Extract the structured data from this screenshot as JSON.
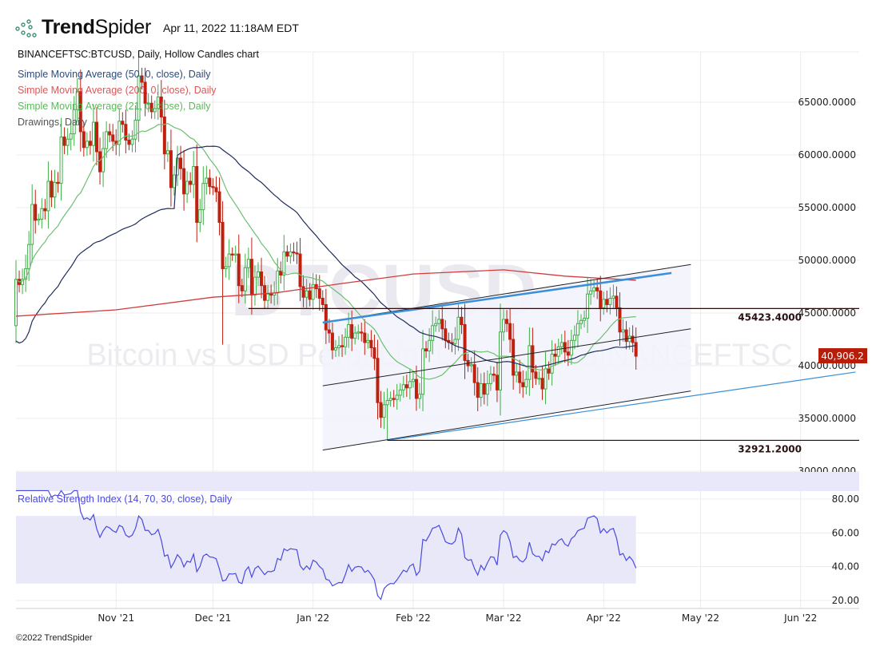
{
  "header": {
    "brand_bold": "Trend",
    "brand_light": "Spider",
    "timestamp": "Apr 11, 2022 11:18AM EDT",
    "chart_title": "BINANCEFTSC:BTCUSD, Daily, Hollow Candles chart",
    "legend": [
      {
        "label": "Simple Moving Average (50, 0, close), Daily",
        "color": "#2e4a7a"
      },
      {
        "label": "Simple Moving Average (200, 0, close), Daily",
        "color": "#d23b3b"
      },
      {
        "label": "Simple Moving Average (21, 0, close), Daily",
        "color": "#5cb85c"
      },
      {
        "label": "Drawings, Daily",
        "color": "#555555"
      }
    ]
  },
  "watermark": {
    "symbol": "BTCUSD",
    "description": "Bitcoin vs USD Perp. Lin. Contract • BINANCEFTSC"
  },
  "last_price_tag": "40,906.2",
  "footer": "©2022 TrendSpider",
  "colors": {
    "up": "#3fae49",
    "down": "#c0200f",
    "sma50": "#1f2d5c",
    "sma200": "#d23b3b",
    "sma21": "#6cc070",
    "rsi": "#4a4ae0",
    "band": "#e8e8f8",
    "channel_fill": "#f3f3fd",
    "blue_line": "#3a8fd8",
    "tag": "#b81d0a"
  },
  "chart_data": {
    "type": "candlestick",
    "title": "BINANCEFTSC:BTCUSD, Daily, Hollow Candles chart",
    "start_date": "2021-10-01",
    "first_open": 43800,
    "closes": [
      48200,
      47700,
      48200,
      49200,
      51500,
      55300,
      53800,
      53900,
      54900,
      54700,
      57500,
      56000,
      57400,
      57300,
      61700,
      60900,
      61500,
      62000,
      64300,
      66000,
      62200,
      60700,
      61300,
      60900,
      63100,
      60300,
      58400,
      60600,
      62200,
      61900,
      61300,
      61000,
      63200,
      62900,
      61400,
      61000,
      61500,
      63300,
      67500,
      66900,
      64900,
      64900,
      64100,
      64400,
      65500,
      63600,
      60100,
      60400,
      56900,
      58100,
      59700,
      58700,
      56300,
      57500,
      57200,
      58900,
      53600,
      54800,
      57300,
      57800,
      57000,
      56900,
      56500,
      53600,
      49200,
      49400,
      50600,
      50500,
      50600,
      47600,
      47100,
      49300,
      50100,
      46700,
      48400,
      48900,
      47600,
      46200,
      46800,
      46700,
      46900,
      49000,
      48600,
      50800,
      50400,
      50800,
      50700,
      50600,
      47500,
      46500,
      47100,
      46300,
      47700,
      47300,
      46400,
      45800,
      43400,
      43100,
      41500,
      41700,
      41900,
      41800,
      42700,
      43900,
      42600,
      43100,
      43200,
      43100,
      42200,
      42400,
      41700,
      40700,
      36500,
      35100,
      36300,
      36700,
      36900,
      36800,
      37200,
      37700,
      38200,
      37900,
      38500,
      38700,
      36900,
      37300,
      41600,
      41400,
      42400,
      43800,
      44000,
      44400,
      43500,
      42400,
      42200,
      42100,
      42500,
      44600,
      43900,
      40500,
      40000,
      40100,
      38400,
      37000,
      38300,
      37300,
      38300,
      39200,
      39100,
      37700,
      43200,
      44400,
      44000,
      42500,
      39100,
      39400,
      38400,
      38000,
      38700,
      41900,
      39400,
      38800,
      38800,
      37800,
      39700,
      39300,
      41100,
      40900,
      41800,
      42200,
      41300,
      41000,
      42400,
      42900,
      44000,
      44300,
      44500,
      46800,
      47100,
      47400,
      47100,
      45500,
      46300,
      45800,
      46400,
      46600,
      45500,
      43200,
      43400,
      42300,
      42800,
      42200,
      40906
    ],
    "low_overrides": {
      "2021-12-04": 42000,
      "2022-01-24": 32921
    },
    "sma200_points": [
      [
        "2021-10-01",
        44700
      ],
      [
        "2021-11-01",
        45300
      ],
      [
        "2021-12-01",
        46500
      ],
      [
        "2021-12-20",
        46900
      ],
      [
        "2022-01-10",
        47800
      ],
      [
        "2022-02-01",
        48700
      ],
      [
        "2022-03-01",
        49100
      ],
      [
        "2022-03-20",
        48500
      ],
      [
        "2022-04-11",
        48100
      ]
    ],
    "price_axis": {
      "ticks": [
        30000,
        35000,
        40000,
        45000,
        50000,
        55000,
        60000,
        65000
      ],
      "labels": [
        "30000.0000",
        "35000.0000",
        "40000.0000",
        "45000.0000",
        "50000.0000",
        "55000.0000",
        "60000.0000",
        "65000.0000"
      ],
      "range": [
        28000,
        70000
      ]
    },
    "time_axis": {
      "labels": [
        "Nov '21",
        "Dec '21",
        "Jan '22",
        "Feb '22",
        "Mar '22",
        "Apr '22",
        "May '22",
        "Jun '22"
      ],
      "dates": [
        "2021-11-01",
        "2021-12-01",
        "2022-01-01",
        "2022-02-01",
        "2022-03-01",
        "2022-04-01",
        "2022-05-01",
        "2022-06-01"
      ]
    },
    "drawings": {
      "horizontal": [
        {
          "from": "2021-12-12",
          "price": 45423.4,
          "label": "45423.4000"
        },
        {
          "from": "2022-01-24",
          "price": 32921.2,
          "label": "32921.2000"
        }
      ],
      "channel": {
        "from": "2022-01-04",
        "to": "2022-04-28",
        "upper": [
          44100,
          49600
        ],
        "middle": [
          38100,
          43500
        ],
        "lower": [
          32000,
          37600
        ]
      },
      "blue_lines": [
        {
          "from": [
            "2022-01-04",
            44100
          ],
          "to": [
            "2022-04-22",
            48800
          ]
        },
        {
          "from": [
            "2022-01-24",
            32921
          ],
          "to": [
            "2022-06-18",
            39400
          ]
        }
      ]
    },
    "rsi": {
      "label": "Relative Strength Index (14, 70, 30, close), Daily",
      "period": 14,
      "ticks": [
        20,
        40,
        60,
        80
      ],
      "labels": [
        "20.00",
        "40.00",
        "60.00",
        "80.00"
      ],
      "band": [
        30,
        70
      ]
    }
  }
}
